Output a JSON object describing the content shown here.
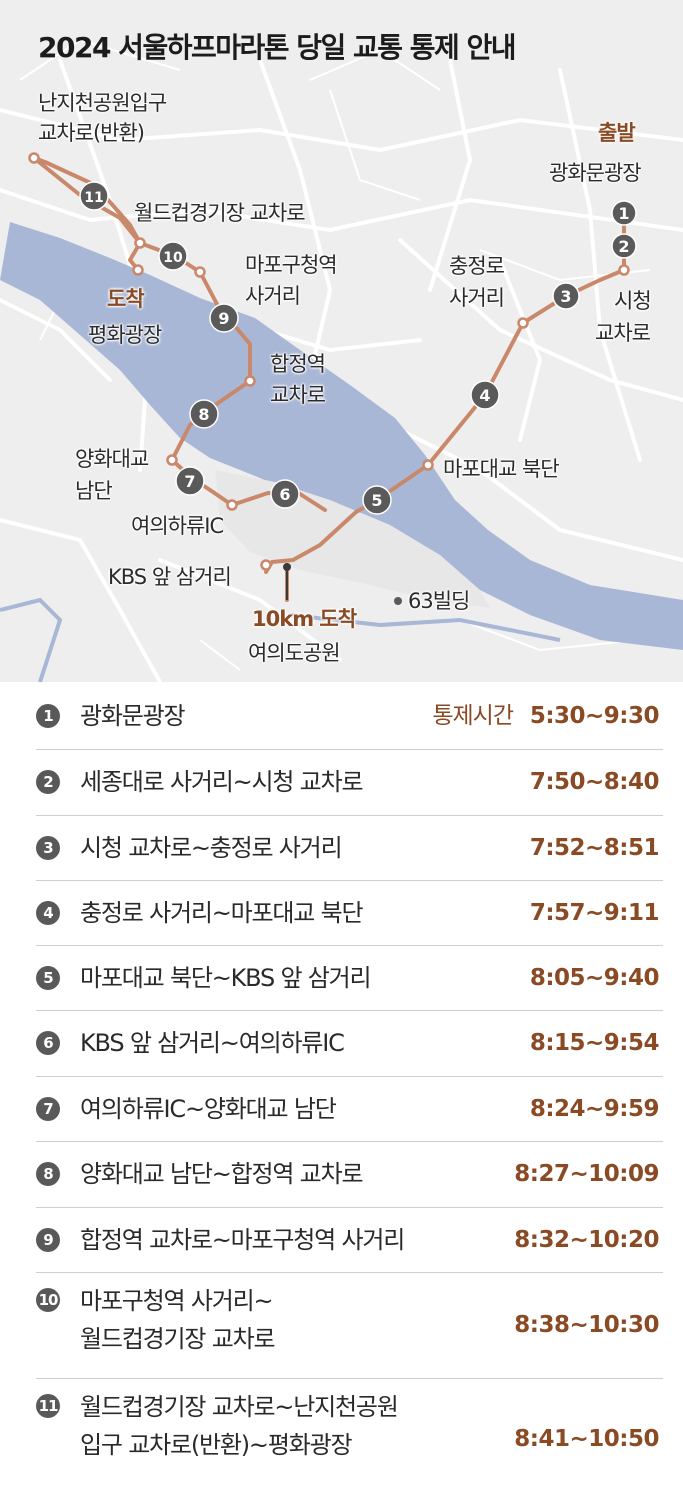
{
  "title": "2024 서울하프마라톤 당일 교통 통제 안내",
  "colors": {
    "route": "#c9886a",
    "accent": "#8a4a24",
    "marker": "#5a5a5a",
    "river": "#a9b7d6",
    "land": "#eeeeee",
    "road": "#ffffff"
  },
  "map": {
    "start_label": "출발",
    "start_place": "광화문광장",
    "finish_label": "도착",
    "finish_place": "평화광장",
    "finish_10k_label": "10km 도착",
    "finish_10k_place": "여의도공원",
    "landmark_63": "63빌딩",
    "places": {
      "nanji_line1": "난지천공원입구",
      "nanji_line2": "교차로(반환)",
      "worldcup": "월드컵경기장 교차로",
      "mapo_office_line1": "마포구청역",
      "mapo_office_line2": "사거리",
      "chungjeong_line1": "충정로",
      "chungjeong_line2": "사거리",
      "cityhall_line1": "시청",
      "cityhall_line2": "교차로",
      "hapjeong_line1": "합정역",
      "hapjeong_line2": "교차로",
      "mapo_bridge": "마포대교 북단",
      "yanghwa_line1": "양화대교",
      "yanghwa_line2": "남단",
      "yeouiharyu": "여의하류IC",
      "kbs": "KBS 앞 삼거리"
    },
    "markers": [
      "1",
      "2",
      "3",
      "4",
      "5",
      "6",
      "7",
      "8",
      "9",
      "10",
      "11"
    ]
  },
  "schedule": {
    "control_time_label": "통제시간",
    "rows": [
      {
        "num": "1",
        "segment_line1": "광화문광장",
        "segment_line2": "",
        "time": "5:30~9:30"
      },
      {
        "num": "2",
        "segment_line1": "세종대로 사거리~시청 교차로",
        "segment_line2": "",
        "time": "7:50~8:40"
      },
      {
        "num": "3",
        "segment_line1": "시청 교차로~충정로 사거리",
        "segment_line2": "",
        "time": "7:52~8:51"
      },
      {
        "num": "4",
        "segment_line1": "충정로 사거리~마포대교 북단",
        "segment_line2": "",
        "time": "7:57~9:11"
      },
      {
        "num": "5",
        "segment_line1": "마포대교 북단~KBS 앞 삼거리",
        "segment_line2": "",
        "time": "8:05~9:40"
      },
      {
        "num": "6",
        "segment_line1": "KBS 앞 삼거리~여의하류IC",
        "segment_line2": "",
        "time": "8:15~9:54"
      },
      {
        "num": "7",
        "segment_line1": "여의하류IC~양화대교 남단",
        "segment_line2": "",
        "time": "8:24~9:59"
      },
      {
        "num": "8",
        "segment_line1": "양화대교 남단~합정역 교차로",
        "segment_line2": "",
        "time": "8:27~10:09"
      },
      {
        "num": "9",
        "segment_line1": "합정역 교차로~마포구청역 사거리",
        "segment_line2": "",
        "time": "8:32~10:20"
      },
      {
        "num": "10",
        "segment_line1": "마포구청역 사거리~",
        "segment_line2": "월드컵경기장 교차로",
        "time": "8:38~10:30"
      },
      {
        "num": "11",
        "segment_line1": "월드컵경기장 교차로~난지천공원",
        "segment_line2": "입구 교차로(반환)~평화광장",
        "time": "8:41~10:50"
      }
    ]
  }
}
